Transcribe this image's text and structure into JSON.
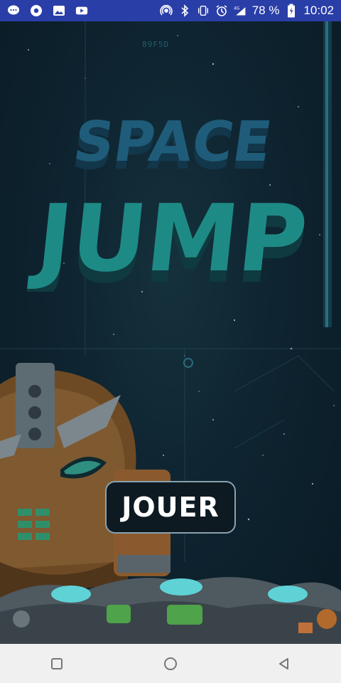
{
  "status_bar": {
    "battery_percent": "78 %",
    "time": "10:02",
    "network": "4G",
    "icons": [
      "message-icon",
      "chrome-icon",
      "gallery-icon",
      "youtube-icon",
      "hotspot-icon",
      "bluetooth-icon",
      "vibrate-icon",
      "alarm-icon",
      "signal-icon",
      "battery-icon"
    ]
  },
  "game": {
    "title_line1": "SPACE",
    "title_line2": "JUMP",
    "hud_tag": "89F5D",
    "play_button_label": "JOUER",
    "colors": {
      "title_space": "#1f5c7a",
      "title_jump": "#1e8a86",
      "button_bg": "#0d1a22",
      "button_border": "#8aa2ae"
    }
  },
  "nav_bar": {
    "buttons": [
      "recent-apps-button",
      "home-button",
      "back-button"
    ]
  }
}
